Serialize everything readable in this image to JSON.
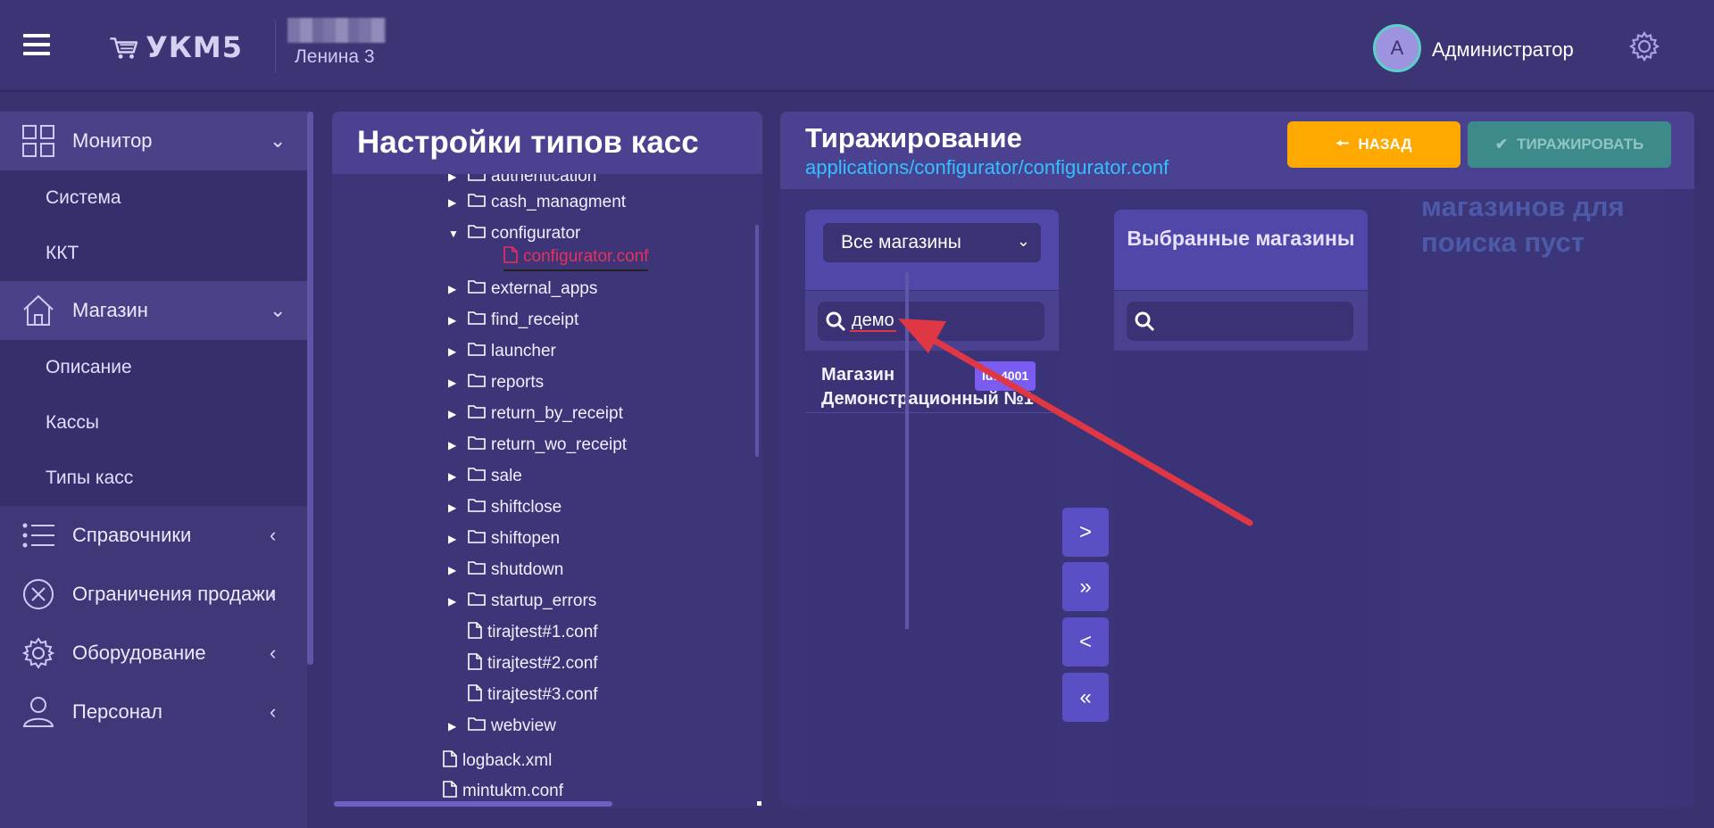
{
  "header": {
    "logo_text": "УКМ5",
    "store_name": "Ленина 3",
    "avatar_letter": "A",
    "user_name": "Администратор"
  },
  "sidebar": {
    "groups": [
      {
        "label": "Монитор",
        "icon": "grid-icon",
        "subitems": [
          "Система",
          "ККТ"
        ]
      },
      {
        "label": "Магазин",
        "icon": "house-icon",
        "subitems": [
          "Описание",
          "Кассы",
          "Типы касс"
        ]
      },
      {
        "label": "Справочники",
        "icon": "list-icon"
      },
      {
        "label": "Ограничения продажи",
        "icon": "forbidden-icon"
      },
      {
        "label": "Оборудование",
        "icon": "gear-icon"
      },
      {
        "label": "Персонал",
        "icon": "user-icon"
      }
    ]
  },
  "tree": {
    "title": "Настройки типов касс",
    "rows": [
      {
        "label": "authentication",
        "type": "folder",
        "expandable": true
      },
      {
        "label": "cash_managment",
        "type": "folder",
        "expandable": true
      },
      {
        "label": "configurator",
        "type": "folder",
        "expanded": true
      },
      {
        "label": "configurator.conf",
        "type": "file",
        "selected": true
      },
      {
        "label": "external_apps",
        "type": "folder",
        "expandable": true
      },
      {
        "label": "find_receipt",
        "type": "folder",
        "expandable": true
      },
      {
        "label": "launcher",
        "type": "folder",
        "expandable": true
      },
      {
        "label": "reports",
        "type": "folder",
        "expandable": true
      },
      {
        "label": "return_by_receipt",
        "type": "folder",
        "expandable": true
      },
      {
        "label": "return_wo_receipt",
        "type": "folder",
        "expandable": true
      },
      {
        "label": "sale",
        "type": "folder",
        "expandable": true
      },
      {
        "label": "shiftclose",
        "type": "folder",
        "expandable": true
      },
      {
        "label": "shiftopen",
        "type": "folder",
        "expandable": true
      },
      {
        "label": "shutdown",
        "type": "folder",
        "expandable": true
      },
      {
        "label": "startup_errors",
        "type": "folder",
        "expandable": true
      },
      {
        "label": "tirajtest#1.conf",
        "type": "file"
      },
      {
        "label": "tirajtest#2.conf",
        "type": "file"
      },
      {
        "label": "tirajtest#3.conf",
        "type": "file"
      },
      {
        "label": "webview",
        "type": "folder",
        "expandable": true
      },
      {
        "label": "logback.xml",
        "type": "file"
      },
      {
        "label": "mintukm.conf",
        "type": "file"
      }
    ]
  },
  "replication": {
    "title": "Тиражирование",
    "path": "applications/configurator/configurator.conf",
    "back_label": "НАЗАД",
    "replicate_label": "ТИРАЖИРОВАТЬ",
    "store_filter": "Все магазины",
    "search_value": "демо",
    "selected_title": "Выбранные магазины",
    "selected_search_value": "",
    "results": [
      {
        "name": "Магазин Демонстрационный №1",
        "id_badge": "Id: 4001"
      }
    ],
    "move_buttons": [
      ">",
      "»",
      "<",
      "«"
    ],
    "right_message": "магазинов для поиска пуст"
  },
  "colors": {
    "accent_orange": "#ffa800",
    "path_blue": "#33c0ff",
    "annotation_red": "#e03744"
  }
}
